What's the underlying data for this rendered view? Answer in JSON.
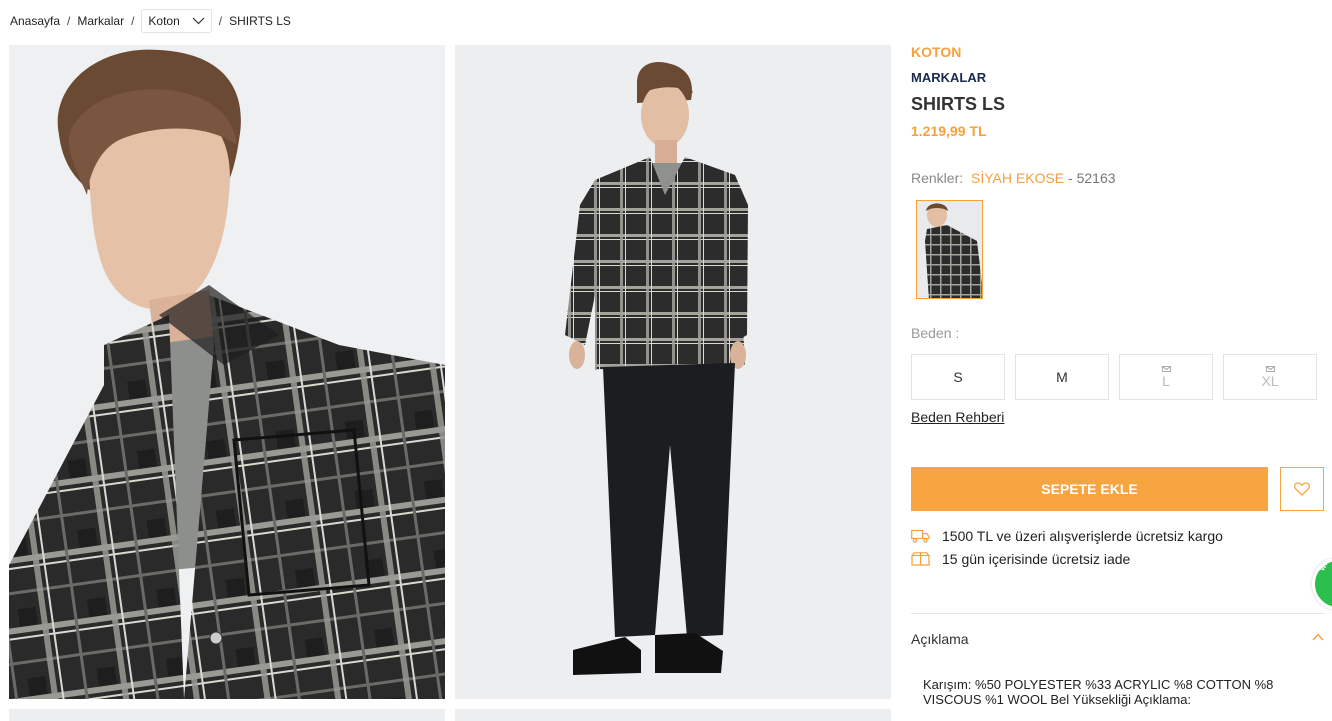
{
  "breadcrumb": {
    "home": "Anasayfa",
    "brands": "Markalar",
    "brand_dropdown": "Koton",
    "current": "SHIRTS LS",
    "separator": "/"
  },
  "product": {
    "brand": "KOTON",
    "category": "MARKALAR",
    "title": "SHIRTS LS",
    "price": "1.219,99 TL"
  },
  "colors": {
    "label": "Renkler:",
    "name": "SİYAH EKOSE",
    "code": "- 52163"
  },
  "sizes": {
    "label": "Beden :",
    "options": [
      {
        "label": "S",
        "available": true
      },
      {
        "label": "M",
        "available": true
      },
      {
        "label": "L",
        "available": false
      },
      {
        "label": "XL",
        "available": false
      }
    ],
    "guide": "Beden Rehberi"
  },
  "actions": {
    "add_to_cart": "SEPETE EKLE"
  },
  "features": [
    {
      "icon": "truck-icon",
      "text": "1500 TL ve üzeri alışverişlerde ücretsiz kargo"
    },
    {
      "icon": "box-icon",
      "text": "15 gün içerisinde ücretsiz iade"
    }
  ],
  "description": {
    "title": "Açıklama",
    "text": "Karışım: %50 POLYESTER %33 ACRYLIC %8 COTTON %8 VISCOUS %1 WOOL Bel Yüksekliği Açıklama:"
  },
  "widgets": {
    "whatsapp": "WHATSAPP"
  },
  "colors_theme": {
    "accent": "#f7a138",
    "navy": "#1c2a4f",
    "whatsapp": "#2dbf4e"
  }
}
